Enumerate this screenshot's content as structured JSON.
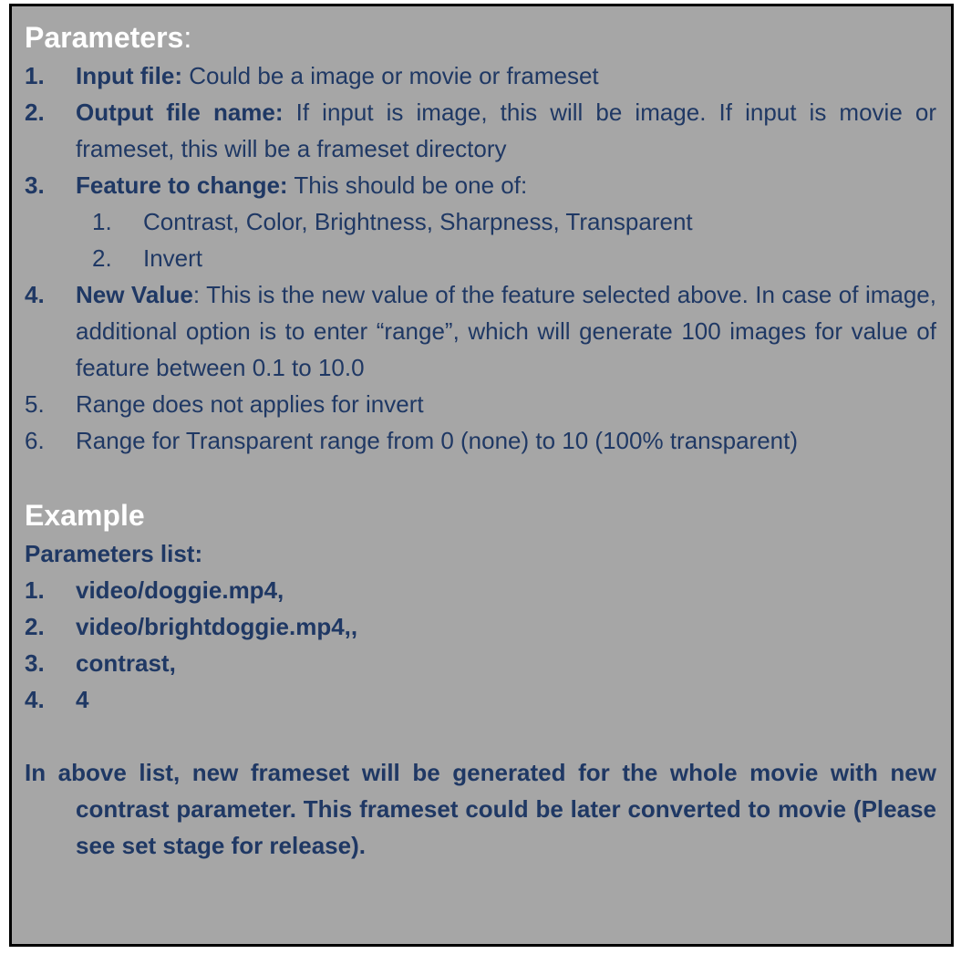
{
  "colors": {
    "panel_background": "#a6a6a6",
    "heading_text": "#ffffff",
    "body_text": "#1f3864",
    "border": "#000000"
  },
  "parameters": {
    "heading": "Parameters",
    "heading_colon": ":",
    "items": [
      {
        "num": "1.",
        "term": "Input file:",
        "text": " Could be a image or movie or frameset"
      },
      {
        "num": "2.",
        "term": "Output file name:",
        "text": " If input is image, this will be image. If input is movie or frameset, this will be a frameset directory"
      },
      {
        "num": "3.",
        "term": "Feature to change:",
        "text": " This should be one of:"
      },
      {
        "num": "4.",
        "term": "New Value",
        "text": ": This is the new value of the feature selected above. In case of image, additional option is to enter “range”, which will generate 100 images for value of feature between 0.1 to 10.0"
      },
      {
        "num": "5.",
        "text": "Range does not applies for invert"
      },
      {
        "num": "6.",
        "text": "Range for Transparent range from 0 (none) to 10 (100% transparent)"
      }
    ],
    "feature_options": [
      {
        "num": "1.",
        "text": "Contrast, Color, Brightness, Sharpness, Transparent"
      },
      {
        "num": "2.",
        "text": "Invert"
      }
    ]
  },
  "example": {
    "heading": "Example",
    "list_title": "Parameters list:",
    "items": [
      {
        "num": "1.",
        "text": "video/doggie.mp4,"
      },
      {
        "num": "2.",
        "text": "video/brightdoggie.mp4,,"
      },
      {
        "num": "3.",
        "text": "contrast,"
      },
      {
        "num": "4.",
        "text": "4"
      }
    ],
    "note": "In above list, new frameset will be generated for the whole movie with new contrast parameter. This frameset could be later converted to movie (Please see set stage for release)."
  }
}
